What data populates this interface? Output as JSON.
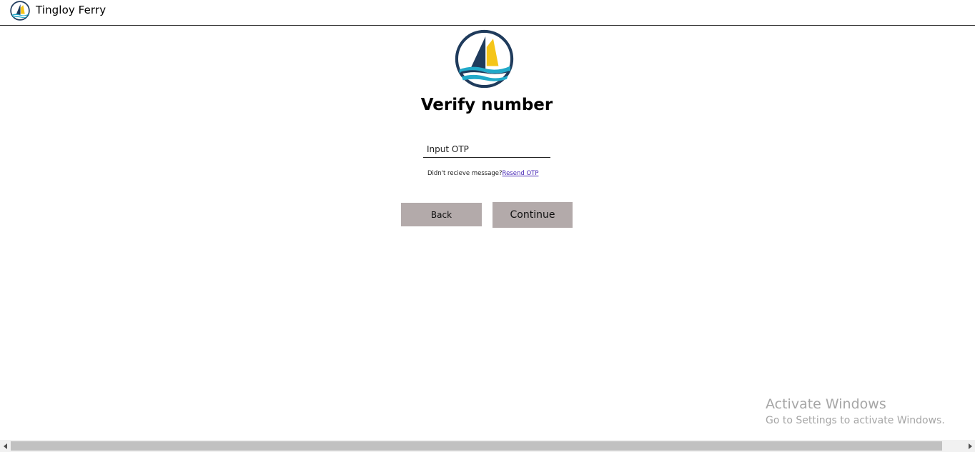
{
  "app": {
    "title": "Tingloy Ferry",
    "logo_icon": "sailboat-logo-icon"
  },
  "page": {
    "heading": "Verify number"
  },
  "otp": {
    "placeholder": "Input OTP",
    "value": ""
  },
  "resend": {
    "prompt": "Didn't recieve message?",
    "link_label": "Resend OTP"
  },
  "actions": {
    "back_label": "Back",
    "continue_label": "Continue"
  },
  "watermark": {
    "title": "Activate Windows",
    "subtitle": "Go to Settings to activate Windows."
  },
  "colors": {
    "navy": "#1f3b5c",
    "yellow": "#f5c518",
    "teal": "#21a9c9",
    "button_bg": "#b3aaaa",
    "link": "#4b2bb8"
  }
}
